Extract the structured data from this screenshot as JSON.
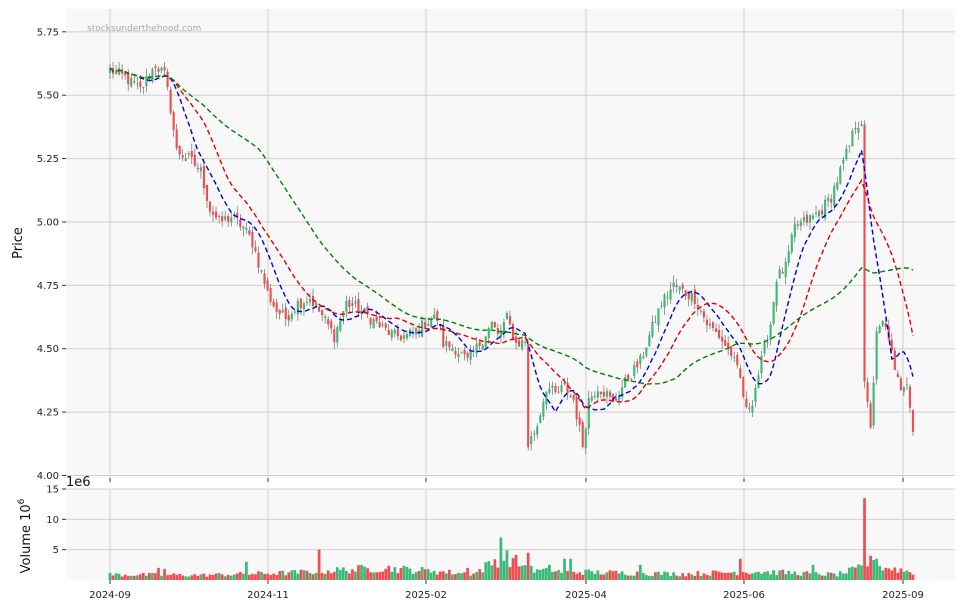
{
  "watermark": "stocksunderthehood.com",
  "chart_data": {
    "type": "candlestick",
    "price_panel": {
      "ylabel": "Price",
      "ylim": [
        3.99,
        5.84
      ],
      "yticks": [
        4.0,
        4.25,
        4.5,
        4.75,
        5.0,
        5.25,
        5.5,
        5.75
      ],
      "ytick_labels": [
        "4.00",
        "4.25",
        "4.50",
        "4.75",
        "5.00",
        "5.25",
        "5.50",
        "5.75"
      ],
      "grid": true
    },
    "volume_panel": {
      "ylabel": "Volume  10",
      "ylabel_exp": "6",
      "offset_label": "1e6",
      "ylim": [
        0,
        15
      ],
      "yticks": [
        5,
        10,
        15
      ],
      "ytick_labels": [
        "5",
        "10",
        "15"
      ],
      "grid": true
    },
    "x_axis": {
      "ticks": [
        "2024-09",
        "2024-11",
        "2025-02",
        "2025-04",
        "2025-06",
        "2025-09"
      ]
    },
    "colors": {
      "up": "#3cb878",
      "down": "#f04e4e",
      "ma_short": "#0000dd",
      "ma_mid": "#e00000",
      "ma_long": "#008000",
      "background": "#f8f8f8"
    },
    "close_anchors": [
      [
        0,
        5.6
      ],
      [
        5,
        5.57
      ],
      [
        10,
        5.52
      ],
      [
        15,
        5.62
      ],
      [
        18,
        5.58
      ],
      [
        20,
        5.45
      ],
      [
        22,
        5.28
      ],
      [
        26,
        5.25
      ],
      [
        30,
        5.2
      ],
      [
        33,
        5.05
      ],
      [
        36,
        5.0
      ],
      [
        40,
        5.02
      ],
      [
        44,
        4.98
      ],
      [
        47,
        4.92
      ],
      [
        50,
        4.8
      ],
      [
        52,
        4.72
      ],
      [
        55,
        4.65
      ],
      [
        58,
        4.62
      ],
      [
        62,
        4.68
      ],
      [
        66,
        4.7
      ],
      [
        70,
        4.63
      ],
      [
        74,
        4.55
      ],
      [
        78,
        4.68
      ],
      [
        82,
        4.66
      ],
      [
        86,
        4.62
      ],
      [
        90,
        4.58
      ],
      [
        94,
        4.55
      ],
      [
        98,
        4.55
      ],
      [
        102,
        4.58
      ],
      [
        106,
        4.62
      ],
      [
        108,
        4.62
      ],
      [
        110,
        4.52
      ],
      [
        114,
        4.5
      ],
      [
        118,
        4.45
      ],
      [
        122,
        4.52
      ],
      [
        126,
        4.6
      ],
      [
        128,
        4.55
      ],
      [
        131,
        4.62
      ],
      [
        134,
        4.52
      ],
      [
        137,
        4.53
      ],
      [
        138,
        4.12
      ],
      [
        141,
        4.2
      ],
      [
        144,
        4.35
      ],
      [
        147,
        4.32
      ],
      [
        150,
        4.35
      ],
      [
        153,
        4.3
      ],
      [
        156,
        4.12
      ],
      [
        158,
        4.3
      ],
      [
        161,
        4.35
      ],
      [
        164,
        4.32
      ],
      [
        166,
        4.28
      ],
      [
        169,
        4.35
      ],
      [
        172,
        4.4
      ],
      [
        175,
        4.45
      ],
      [
        178,
        4.55
      ],
      [
        182,
        4.68
      ],
      [
        186,
        4.75
      ],
      [
        190,
        4.72
      ],
      [
        193,
        4.7
      ],
      [
        197,
        4.6
      ],
      [
        201,
        4.55
      ],
      [
        205,
        4.48
      ],
      [
        208,
        4.38
      ],
      [
        210,
        4.25
      ],
      [
        212,
        4.3
      ],
      [
        215,
        4.45
      ],
      [
        218,
        4.6
      ],
      [
        220,
        4.78
      ],
      [
        223,
        4.82
      ],
      [
        226,
        4.98
      ],
      [
        229,
        5.0
      ],
      [
        232,
        5.02
      ],
      [
        235,
        5.05
      ],
      [
        238,
        5.1
      ],
      [
        241,
        5.2
      ],
      [
        244,
        5.3
      ],
      [
        246,
        5.38
      ],
      [
        248,
        5.4
      ],
      [
        249,
        4.35
      ],
      [
        251,
        4.2
      ],
      [
        253,
        4.55
      ],
      [
        255,
        4.6
      ],
      [
        257,
        4.55
      ],
      [
        259,
        4.4
      ],
      [
        261,
        4.35
      ],
      [
        263,
        4.38
      ],
      [
        265,
        4.18
      ]
    ],
    "volume_anchors": [
      [
        0,
        0.9
      ],
      [
        30,
        0.8
      ],
      [
        60,
        1.2
      ],
      [
        90,
        2.0
      ],
      [
        120,
        1.0
      ],
      [
        125,
        2.5
      ],
      [
        130,
        4.0
      ],
      [
        140,
        1.5
      ],
      [
        165,
        1.2
      ],
      [
        190,
        1.0
      ],
      [
        212,
        1.4
      ],
      [
        240,
        0.9
      ],
      [
        248,
        2.0
      ],
      [
        250,
        2.6
      ],
      [
        265,
        1.3
      ]
    ],
    "volume_spikes": [
      [
        16,
        2.0
      ],
      [
        18,
        1.8
      ],
      [
        45,
        3.0
      ],
      [
        69,
        5.0
      ],
      [
        107,
        1.5
      ],
      [
        118,
        2.0
      ],
      [
        129,
        7.0
      ],
      [
        138,
        4.5
      ],
      [
        145,
        2.5
      ],
      [
        150,
        3.5
      ],
      [
        152,
        3.5
      ],
      [
        175,
        2.5
      ],
      [
        208,
        3.5
      ],
      [
        232,
        2.5
      ],
      [
        249,
        13.5
      ],
      [
        251,
        4.0
      ],
      [
        253,
        3.5
      ]
    ],
    "ma_windows": [
      10,
      20,
      50
    ]
  }
}
